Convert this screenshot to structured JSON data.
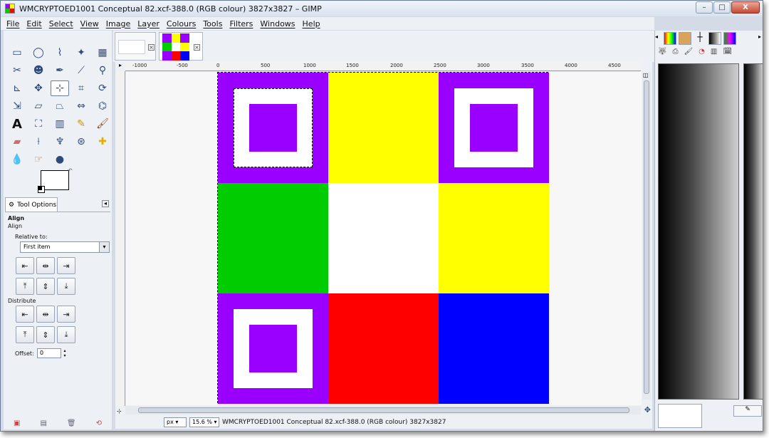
{
  "window": {
    "title": "WMCRYPTOED1001 Conceptual 82.xcf-388.0 (RGB colour) 3827x3827 – GIMP",
    "controls": [
      "–",
      "□",
      "X"
    ]
  },
  "menubar": {
    "items": [
      "File",
      "Edit",
      "Select",
      "View",
      "Image",
      "Layer",
      "Colours",
      "Tools",
      "Filters",
      "Windows",
      "Help"
    ]
  },
  "toolbox": {
    "tools": [
      "rect-select",
      "ellipse-select",
      "free-select",
      "fuzzy-select",
      "by-color-select",
      "scissors-select",
      "foreground-select",
      "paths",
      "color-picker",
      "zoom",
      "measure",
      "move",
      "align",
      "crop",
      "rotate",
      "scale",
      "shear",
      "perspective",
      "flip",
      "cage-transform",
      "text",
      "bucket-fill",
      "blend",
      "pencil",
      "paintbrush",
      "eraser",
      "airbrush",
      "ink",
      "clone",
      "heal",
      "blur",
      "smudge",
      "dodge-burn"
    ],
    "active_tool": "align"
  },
  "tool_options": {
    "tab_label": "Tool Options",
    "heading": "Align",
    "subheading": "Align",
    "relative_to_label": "Relative to:",
    "relative_to_value": "First item",
    "distribute_label": "Distribute",
    "offset_label": "Offset:",
    "offset_value": "0"
  },
  "image": {
    "cells": [
      "#9900ff",
      "#ffff00",
      "#9900ff",
      "#00cc00",
      "#ffffff",
      "#ffff00",
      "#9900ff",
      "#ff0000",
      "#0000ff"
    ],
    "squares_in_cells": [
      0,
      2,
      6
    ],
    "square_outer_color": "#ffffff",
    "square_inner_color": "#9900ff"
  },
  "ruler": {
    "labels": [
      "-1000",
      "-500",
      "0",
      "500",
      "1000",
      "1500",
      "2000",
      "2500",
      "3000",
      "3500",
      "4000",
      "4500"
    ]
  },
  "statusbar": {
    "unit": "px",
    "zoom": "15.6 %",
    "text": "WMCRYPTOED1001 Conceptual 82.xcf-388.0 (RGB colour) 3827x3827"
  },
  "colors": {
    "accent": "#2f4b7c",
    "panel": "#edf0f5"
  }
}
